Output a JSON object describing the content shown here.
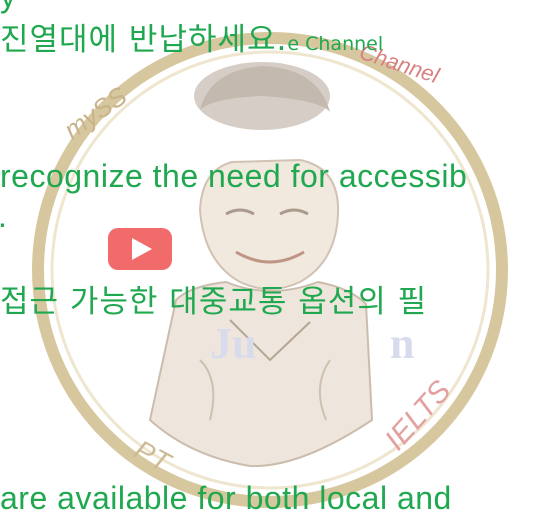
{
  "subtitles": {
    "top_fragment": "y",
    "line1_korean": "진열대에 반납하세요.",
    "line1_tail": "e Channel",
    "line2_english": "recognize the need for accessib",
    "line3_fragment": ".",
    "line4_korean": "접근 가능한 대중교통 옵션의 필",
    "line5_english": "are available for both local and"
  },
  "watermark": {
    "ring_text_top_left": "mySS",
    "ring_text_right": "IELTS",
    "ring_text_bottom": "PT",
    "play_button_color": "#f26b6b",
    "ring_color": "#c8b38a"
  }
}
